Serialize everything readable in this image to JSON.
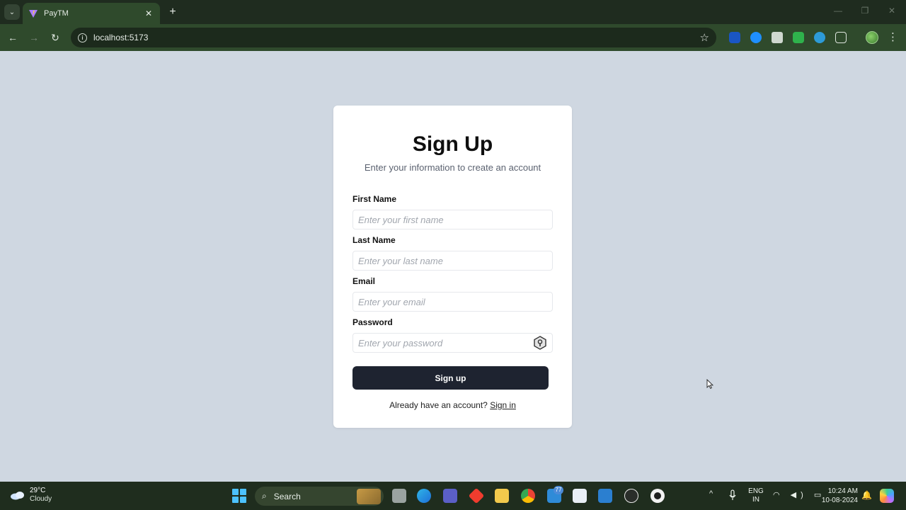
{
  "browser": {
    "tab_title": "PayTM",
    "url": "localhost:5173",
    "tab_close_glyph": "✕",
    "new_tab_glyph": "+",
    "back_glyph": "←",
    "forward_glyph": "→",
    "reload_glyph": "↻",
    "bookmark_glyph": "☆",
    "menu_glyph": "⋮",
    "minimize_glyph": "—",
    "restore_glyph": "❐",
    "window_close_glyph": "✕",
    "tab_list_glyph": "⌄",
    "extensions": [
      "bitwarden-icon",
      "shazam-icon",
      "hexagon-extension-icon",
      "shield-extension-icon",
      "globe-extension-icon",
      "puzzle-extensions-icon"
    ]
  },
  "form": {
    "title": "Sign Up",
    "subtitle": "Enter your information to create an account",
    "first_name_label": "First Name",
    "first_name_placeholder": "Enter your first name",
    "last_name_label": "Last Name",
    "last_name_placeholder": "Enter your last name",
    "email_label": "Email",
    "email_placeholder": "Enter your email",
    "password_label": "Password",
    "password_placeholder": "Enter your password",
    "submit_label": "Sign up",
    "footer_text": "Already have an account?",
    "footer_link": "Sign in"
  },
  "taskbar": {
    "weather_temp": "29°C",
    "weather_condition": "Cloudy",
    "search_label": "Search",
    "search_glyph": "⌕",
    "mail_badge": "77",
    "lang_line1": "ENG",
    "lang_line2": "IN",
    "clock_time": "10:24 AM",
    "clock_date": "10-08-2024",
    "tray_up_glyph": "^",
    "tray_glyphs": "◠ ◀) ▭",
    "bell_glyph": "🔔",
    "apps": [
      "file-explorer-icon",
      "edge-icon",
      "teams-icon",
      "git-icon",
      "folder-icon",
      "chrome-icon",
      "mail-icon",
      "store-icon",
      "vscode-icon",
      "obs-icon",
      "mongodb-icon"
    ]
  },
  "colors": {
    "page_background": "#cfd7e1",
    "card_background": "#ffffff",
    "button_background": "#1e2330",
    "chrome_green": "#2f4a2c"
  }
}
